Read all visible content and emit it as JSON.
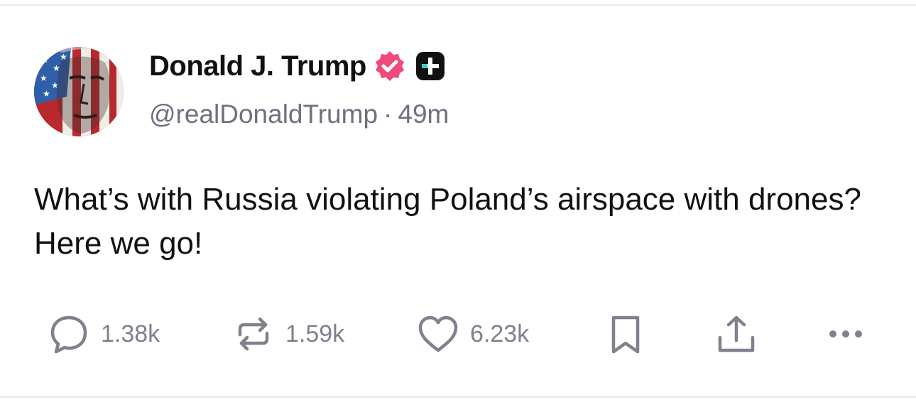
{
  "post": {
    "author": {
      "display_name": "Donald J. Trump",
      "handle": "@realDonaldTrump",
      "verified_badge_icon": "verified-check-icon",
      "verified_badge_color": "#f04a7b",
      "plus_badge_icon": "plus-badge-icon",
      "avatar_icon": "avatar-image"
    },
    "separator": "·",
    "timestamp": "49m",
    "text": "What’s with Russia violating Poland’s airspace with drones? Here we go!",
    "actions": {
      "replies": {
        "icon": "reply-icon",
        "count": "1.38k"
      },
      "reposts": {
        "icon": "repost-icon",
        "count": "1.59k"
      },
      "likes": {
        "icon": "heart-icon",
        "count": "6.23k"
      },
      "bookmark": {
        "icon": "bookmark-icon"
      },
      "share": {
        "icon": "share-icon"
      },
      "more": {
        "icon": "more-icon"
      }
    },
    "colors": {
      "text": "#111111",
      "muted": "#6f6f80",
      "icon": "#80808e",
      "badge_pink": "#f04a7b",
      "plus_badge_bg": "#111111"
    }
  }
}
